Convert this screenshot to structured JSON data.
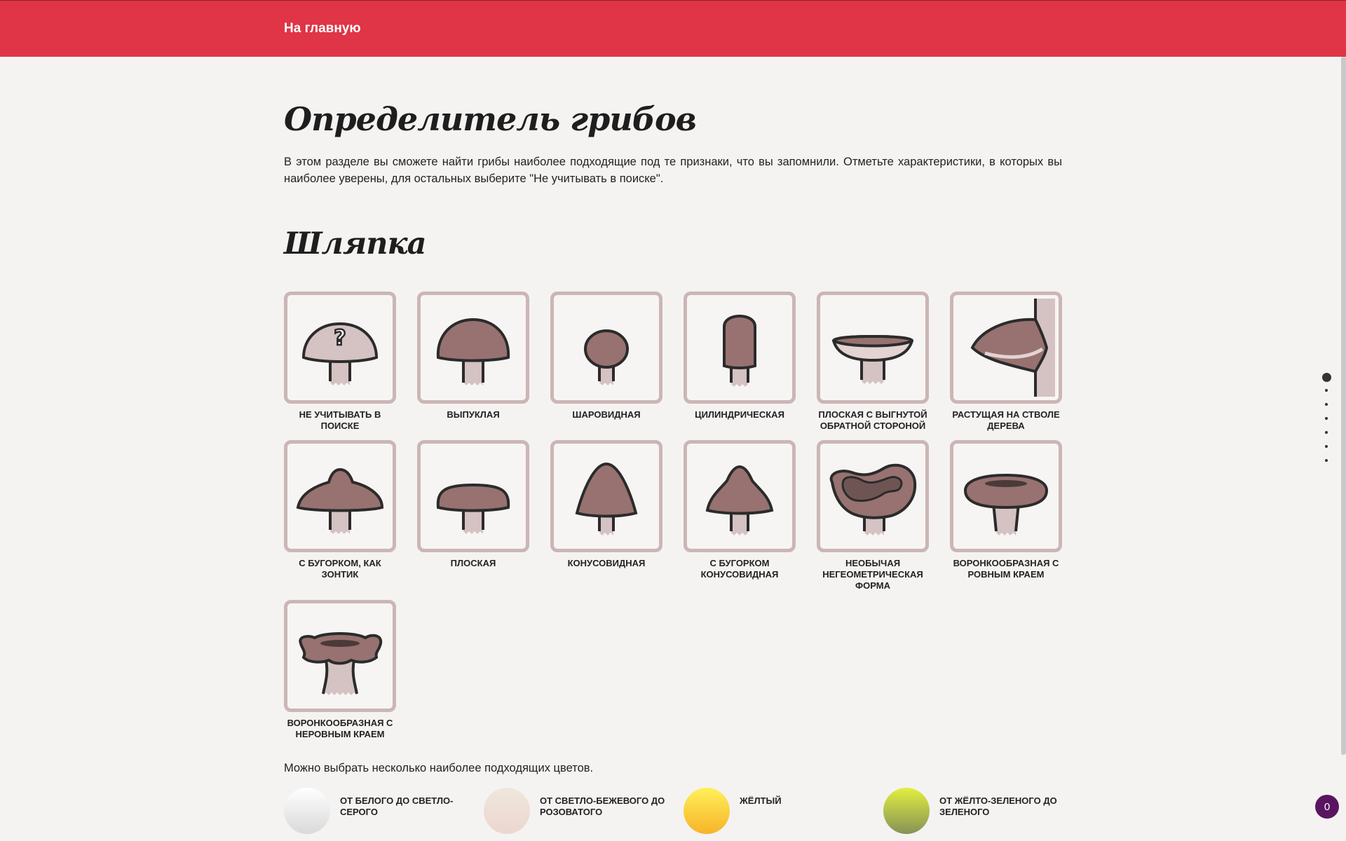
{
  "nav": {
    "home_label": "На главную"
  },
  "page": {
    "title": "Определитель грибов",
    "intro": "В этом разделе вы сможете найти грибы наиболее подходящие под те признаки, что вы запомнили. Отметьте характеристики, в которых вы наиболее уверены, для остальных выберите \"Не учитывать в поиске\"."
  },
  "cap_section": {
    "title": "Шляпка",
    "options": [
      {
        "label": "Не учитывать в поиске",
        "icon": "question-mushroom-icon"
      },
      {
        "label": "Выпуклая",
        "icon": "convex-cap-icon"
      },
      {
        "label": "Шаровидная",
        "icon": "spherical-cap-icon"
      },
      {
        "label": "Цилиндрическая",
        "icon": "cylindrical-cap-icon"
      },
      {
        "label": "Плоская с выгнутой обратной стороной",
        "icon": "flat-curved-underside-cap-icon"
      },
      {
        "label": "Растущая на стволе дерева",
        "icon": "tree-growing-cap-icon"
      },
      {
        "label": "С бугорком, как зонтик",
        "icon": "umbrella-bump-cap-icon"
      },
      {
        "label": "Плоская",
        "icon": "flat-cap-icon"
      },
      {
        "label": "Конусовидная",
        "icon": "conical-cap-icon"
      },
      {
        "label": "С бугорком конусовидная",
        "icon": "conical-bump-cap-icon"
      },
      {
        "label": "Необычая негеометрическая форма",
        "icon": "irregular-cap-icon"
      },
      {
        "label": "Воронкообразная с ровным краем",
        "icon": "funnel-even-edge-cap-icon"
      },
      {
        "label": "Воронкообразная с неровным краем",
        "icon": "funnel-uneven-edge-cap-icon"
      }
    ]
  },
  "colors": {
    "hint": "Можно выбрать несколько наиболее подходящих цветов.",
    "items": [
      {
        "label": "От белого до светло-серого",
        "from": "#ffffff",
        "to": "#d9d9d9"
      },
      {
        "label": "От светло-бежевого до розоватого",
        "from": "#efe7dc",
        "to": "#ecd6d0"
      },
      {
        "label": "Жёлтый",
        "from": "#fff05a",
        "to": "#f7b329"
      },
      {
        "label": "От жёлто-зеленого до зеленого",
        "from": "#e3ef3f",
        "to": "#869256"
      }
    ]
  },
  "side_nav": {
    "count": 7,
    "active_index": 0
  },
  "badge": {
    "count": "0"
  },
  "theme": {
    "accent": "#df3546",
    "cap": "#977270",
    "stem": "#d5c2c2",
    "outline": "#2b2b2b",
    "tile_border": "#cbb6b6"
  }
}
